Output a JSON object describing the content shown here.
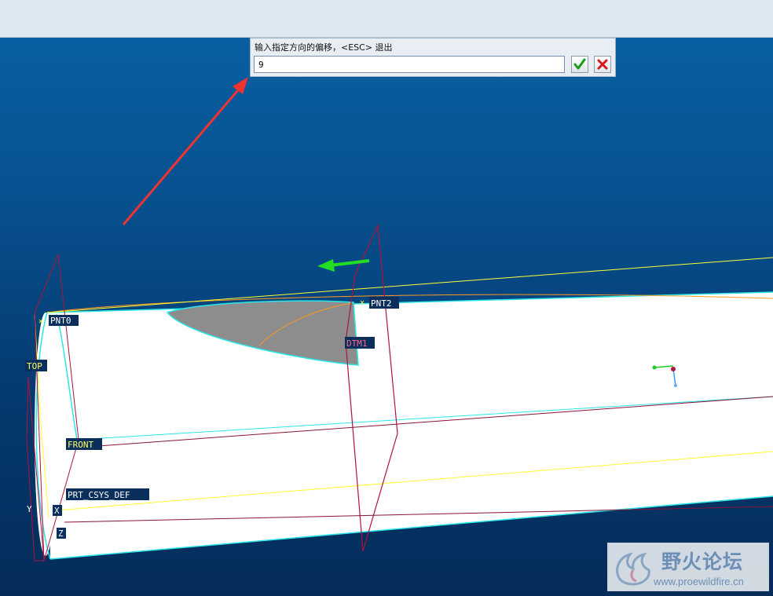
{
  "prompt": {
    "label": "输入指定方向的偏移，<ESC> 退出",
    "value": "9",
    "ok_icon": "green-check-icon",
    "cancel_icon": "red-x-icon"
  },
  "datum_labels": {
    "pnt0": "PNT0",
    "pnt2": "PNT2",
    "dtm1": "DTM1",
    "top": "TOP",
    "front": "FRONT",
    "csys": "PRT_CSYS_DEF",
    "axis_x": "X",
    "axis_y": "Y",
    "axis_z": "Z"
  },
  "watermark": {
    "title": "野火论坛",
    "url": "www.proewildfire.cn"
  },
  "colors": {
    "background_top": "#0a63a6",
    "background_bottom": "#042c59",
    "datum_plane": "#b0123c",
    "edge_highlight": "#2be6e6",
    "datum_curve": "#ffff33",
    "drag_arrow": "#22dd22",
    "annotation_arrow": "#ee3333"
  }
}
